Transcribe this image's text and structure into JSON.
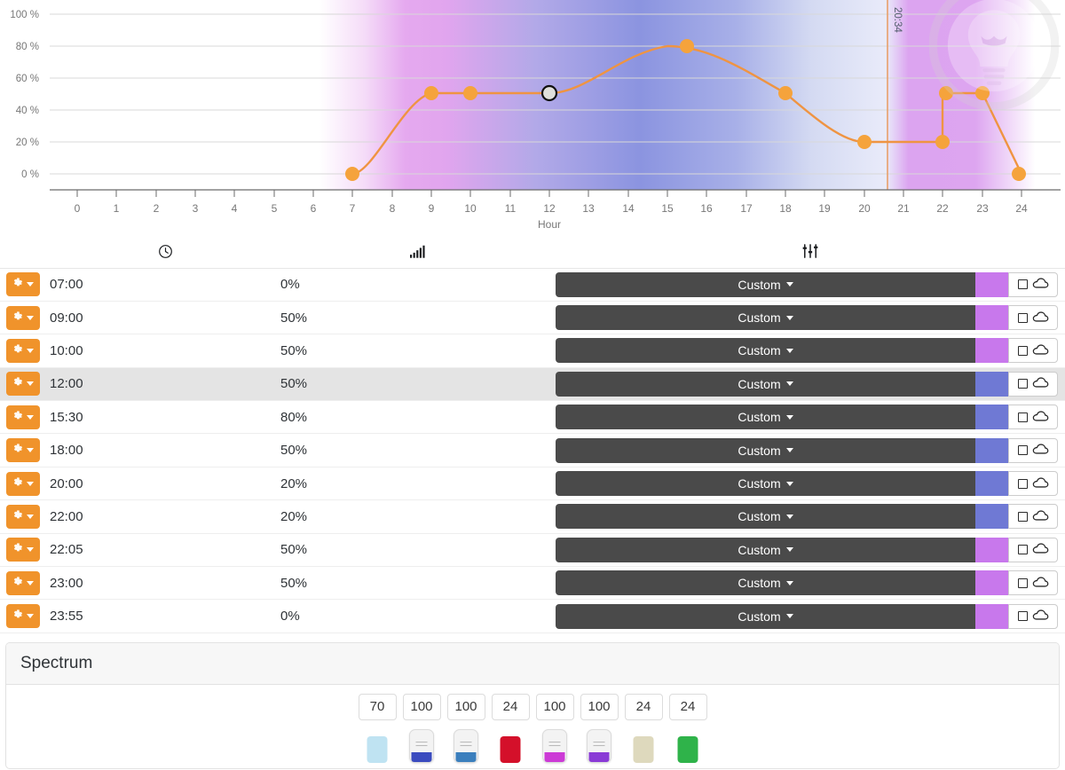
{
  "chart_data": {
    "type": "line",
    "title": "",
    "xlabel": "Hour",
    "ylabel": "",
    "x": [
      7,
      9,
      10,
      12,
      15.5,
      18,
      20,
      22,
      22.083,
      23,
      23.917
    ],
    "values": [
      0,
      50,
      50,
      50,
      80,
      50,
      20,
      20,
      50,
      50,
      0
    ],
    "point_labels": [
      "07:00",
      "09:00",
      "10:00",
      "12:00",
      "15:30",
      "18:00",
      "20:00",
      "22:00",
      "22:05",
      "23:00",
      "23:55"
    ],
    "selected_point_index": 3,
    "xlim": [
      -0.5,
      24.6
    ],
    "ylim": [
      0,
      100
    ],
    "xticks": [
      "0",
      "1",
      "2",
      "3",
      "4",
      "5",
      "6",
      "7",
      "8",
      "9",
      "10",
      "11",
      "12",
      "13",
      "14",
      "15",
      "16",
      "17",
      "18",
      "19",
      "20",
      "21",
      "22",
      "23",
      "24"
    ],
    "yticks": [
      "0 %",
      "20 %",
      "40 %",
      "60 %",
      "80 %",
      "100 %"
    ],
    "ytick_values": [
      0,
      20,
      40,
      60,
      80,
      100
    ],
    "grid": true,
    "legend": "none",
    "line_color": "#f0932b",
    "point_color": "#f5a33c",
    "marker_time_label": "20:34",
    "marker_time_x": 20.57,
    "marker_color": "#e8a06a",
    "background_gradient": [
      {
        "x": 7.0,
        "color": "#ffffff"
      },
      {
        "x": 9.0,
        "color": "#e5a9ef"
      },
      {
        "x": 10.0,
        "color": "#e1a5ee"
      },
      {
        "x": 12.0,
        "color": "#b2a9e8"
      },
      {
        "x": 15.5,
        "color": "#8b94e0"
      },
      {
        "x": 18.0,
        "color": "#a8b0e8"
      },
      {
        "x": 20.0,
        "color": "#d4daf2"
      },
      {
        "x": 22.0,
        "color": "#e9ebfa"
      },
      {
        "x": 22.08,
        "color": "#dca4f0"
      },
      {
        "x": 23.0,
        "color": "#dda5f0"
      },
      {
        "x": 23.92,
        "color": "#ffffff"
      }
    ]
  },
  "table": {
    "headers": [
      {
        "icon": "clock-icon",
        "label": ""
      },
      {
        "icon": "signal-bars-icon",
        "label": ""
      },
      {
        "icon": "sliders-icon",
        "label": ""
      }
    ],
    "row_action_label": "",
    "rows": [
      {
        "time": "07:00",
        "level": "0%",
        "scene": "Custom",
        "color": "#c878ec",
        "active": false
      },
      {
        "time": "09:00",
        "level": "50%",
        "scene": "Custom",
        "color": "#c878ec",
        "active": false
      },
      {
        "time": "10:00",
        "level": "50%",
        "scene": "Custom",
        "color": "#c878ec",
        "active": false
      },
      {
        "time": "12:00",
        "level": "50%",
        "scene": "Custom",
        "color": "#6f79d4",
        "active": true
      },
      {
        "time": "15:30",
        "level": "80%",
        "scene": "Custom",
        "color": "#6f79d4",
        "active": false
      },
      {
        "time": "18:00",
        "level": "50%",
        "scene": "Custom",
        "color": "#6f79d4",
        "active": false
      },
      {
        "time": "20:00",
        "level": "20%",
        "scene": "Custom",
        "color": "#6f79d4",
        "active": false
      },
      {
        "time": "22:00",
        "level": "20%",
        "scene": "Custom",
        "color": "#6f79d4",
        "active": false
      },
      {
        "time": "22:05",
        "level": "50%",
        "scene": "Custom",
        "color": "#c878ec",
        "active": false
      },
      {
        "time": "23:00",
        "level": "50%",
        "scene": "Custom",
        "color": "#c878ec",
        "active": false
      },
      {
        "time": "23:55",
        "level": "0%",
        "scene": "Custom",
        "color": "#c878ec",
        "active": false
      }
    ]
  },
  "spectrum": {
    "title": "Spectrum",
    "channels": [
      {
        "value": "70",
        "color": "#bfe3f2",
        "style": "cap"
      },
      {
        "value": "100",
        "color": "#3a4bbf",
        "style": "thumb"
      },
      {
        "value": "100",
        "color": "#3b7fbd",
        "style": "thumb"
      },
      {
        "value": "24",
        "color": "#d4102a",
        "style": "cap"
      },
      {
        "value": "100",
        "color": "#cc3ad6",
        "style": "thumb"
      },
      {
        "value": "100",
        "color": "#8a3ad6",
        "style": "thumb"
      },
      {
        "value": "24",
        "color": "#ded9bd",
        "style": "cap"
      },
      {
        "value": "24",
        "color": "#2fb34a",
        "style": "cap"
      }
    ]
  }
}
